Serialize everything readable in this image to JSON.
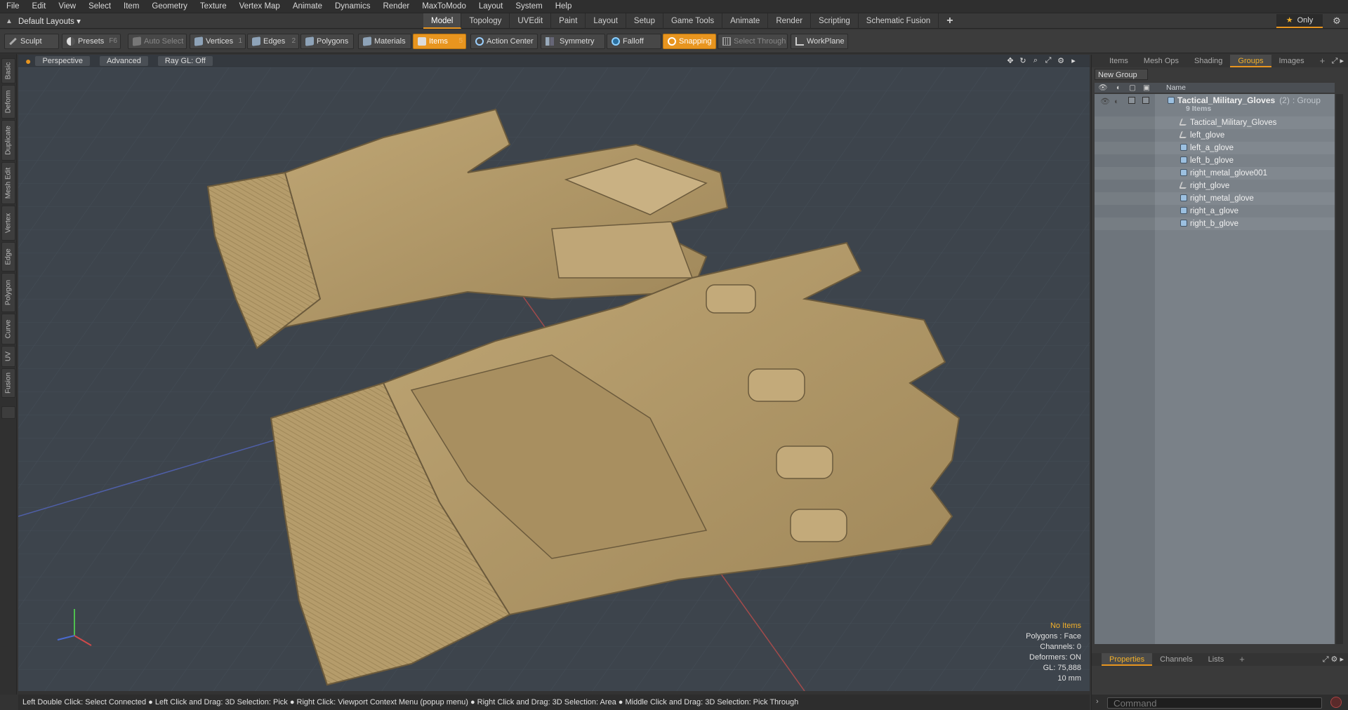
{
  "menu": [
    "File",
    "Edit",
    "View",
    "Select",
    "Item",
    "Geometry",
    "Texture",
    "Vertex Map",
    "Animate",
    "Dynamics",
    "Render",
    "MaxToModo",
    "Layout",
    "System",
    "Help"
  ],
  "layout_label": "Default Layouts",
  "tabs": [
    "Model",
    "Topology",
    "UVEdit",
    "Paint",
    "Layout",
    "Setup",
    "Game Tools",
    "Animate",
    "Render",
    "Scripting",
    "Schematic Fusion",
    "+"
  ],
  "only_label": "Only",
  "toolbar": {
    "sculpt": "Sculpt",
    "presets": "Presets",
    "presets_key": "F6",
    "auto_select": "Auto Select",
    "vertices": "Vertices",
    "vertices_key": "1",
    "edges": "Edges",
    "edges_key": "2",
    "polygons": "Polygons",
    "materials": "Materials",
    "items": "Items",
    "items_key": "5",
    "action_center": "Action Center",
    "symmetry": "Symmetry",
    "falloff": "Falloff",
    "snapping": "Snapping",
    "select_through": "Select Through",
    "workplane": "WorkPlane"
  },
  "left_tabs": [
    "Basic",
    "Deform",
    "Duplicate",
    "Mesh Edit",
    "Vertex",
    "Edge",
    "Polygon",
    "Curve",
    "UV",
    "Fusion"
  ],
  "viewport": {
    "view": "Perspective",
    "shading": "Advanced",
    "raygl": "Ray GL: Off",
    "info": [
      "No Items",
      "Polygons : Face",
      "Channels: 0",
      "Deformers: ON",
      "GL: 75,888",
      "10 mm"
    ]
  },
  "status": "Left Double Click: Select Connected ● Left Click and Drag: 3D Selection: Pick ● Right Click: Viewport Context Menu (popup menu) ● Right Click and Drag: 3D Selection: Area ● Middle Click and Drag: 3D Selection: Pick Through",
  "panel": {
    "tabs": [
      "Items",
      "Mesh Ops",
      "Shading",
      "Groups",
      "Images",
      "+"
    ],
    "new_group": "New Group",
    "name_col": "Name",
    "group": {
      "name": "Tactical_Military_Gloves",
      "count": "(2)",
      "type": ": Group",
      "items": "9 Items"
    },
    "children": [
      {
        "name": "Tactical_Military_Gloves",
        "icon": "locator-icon"
      },
      {
        "name": "left_glove",
        "icon": "locator-icon"
      },
      {
        "name": "left_a_glove",
        "icon": "mesh-icon"
      },
      {
        "name": "left_b_glove",
        "icon": "mesh-icon"
      },
      {
        "name": "right_metal_glove001",
        "icon": "mesh-icon"
      },
      {
        "name": "right_glove",
        "icon": "locator-icon"
      },
      {
        "name": "right_metal_glove",
        "icon": "mesh-icon"
      },
      {
        "name": "right_a_glove",
        "icon": "mesh-icon"
      },
      {
        "name": "right_b_glove",
        "icon": "mesh-icon"
      }
    ],
    "bottom_tabs": [
      "Properties",
      "Channels",
      "Lists",
      "+"
    ],
    "command_placeholder": "Command"
  },
  "colors": {
    "accent": "#e8951f",
    "viewport_bg": "#3d444c",
    "glove": "#b49a6a"
  }
}
